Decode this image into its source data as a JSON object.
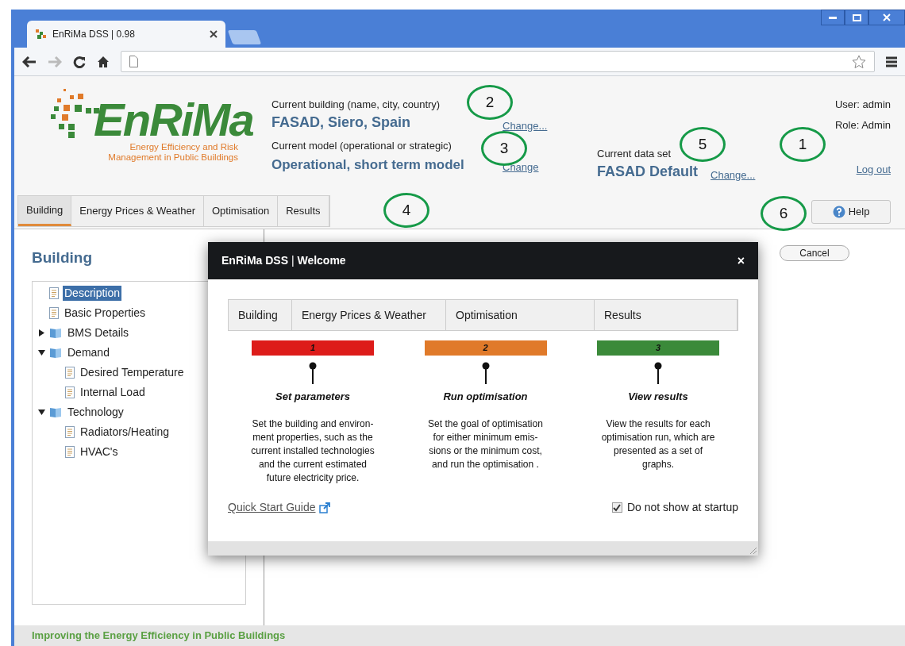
{
  "browser": {
    "tab_title": "EnRiMa DSS | 0.98"
  },
  "header": {
    "logo": {
      "name": "EnRiMa",
      "tagline": "Energy Efficiency and Risk\nManagement in Public Buildings"
    },
    "building": {
      "label": "Current building (name, city, country)",
      "value": "FASAD, Siero, Spain",
      "link": "Change..."
    },
    "model": {
      "label": "Current model (operational or strategic)",
      "value": "Operational, short term model",
      "link": "Change"
    },
    "data_set": {
      "label": "Current data set",
      "value": "FASAD Default",
      "link": "Change..."
    },
    "user": {
      "user": "User: admin",
      "role": "Role: Admin",
      "logout": "Log out"
    }
  },
  "tabs": [
    {
      "label": "Building",
      "selected": true
    },
    {
      "label": "Energy Prices & Weather",
      "selected": false
    },
    {
      "label": "Optimisation",
      "selected": false
    },
    {
      "label": "Results",
      "selected": false
    }
  ],
  "help_button": "Help",
  "sidebar": {
    "title": "Building",
    "tree": [
      {
        "label": "Description",
        "kind": "page",
        "selected": true
      },
      {
        "label": "Basic Properties",
        "kind": "page",
        "selected": false
      },
      {
        "label": "BMS Details",
        "kind": "folder",
        "expanded": false,
        "selected": false
      },
      {
        "label": "Demand",
        "kind": "folder",
        "expanded": true,
        "selected": false,
        "children": [
          {
            "label": "Desired Temperature",
            "kind": "page",
            "selected": false
          },
          {
            "label": "Internal Load",
            "kind": "page",
            "selected": false
          }
        ]
      },
      {
        "label": "Technology",
        "kind": "folder",
        "expanded": true,
        "selected": false,
        "children": [
          {
            "label": "Radiators/Heating",
            "kind": "page",
            "selected": false
          },
          {
            "label": "HVAC's",
            "kind": "page",
            "selected": false
          }
        ]
      }
    ]
  },
  "cancel_button": "Cancel",
  "dialog": {
    "title": "**EnRiMa DSS** | **Welcome**",
    "close": "×",
    "tabs": [
      "Building",
      "Energy Prices & Weather",
      "Optimisation",
      "Results"
    ],
    "steps": [
      {
        "number": "1",
        "color": "#dd1c1a",
        "title": "Set parameters",
        "text": "Set the building and environ-\nment properties, such as the\ncurrent installed technologies\nand the current estimated\nfuture electricity price."
      },
      {
        "number": "2",
        "color": "#e07a2a",
        "title": "Run optimisation",
        "text": "Set the goal of optimisation\nfor either minimum emis-\nsions or the minimum cost,\nand run the optimisation ."
      },
      {
        "number": "3",
        "color": "#3b8a3a",
        "title": "View results",
        "text": "View the results for each\noptimisation run, which are\npresented as a set of\ngraphs."
      }
    ],
    "guide_link": "Quick Start Guide",
    "dont_show": {
      "label": "Do not show at startup",
      "checked": true
    }
  },
  "annotations": [
    "2",
    "3",
    "5",
    "1",
    "4",
    "6"
  ],
  "footer": "Improving the Energy Efficiency in Public Buildings"
}
